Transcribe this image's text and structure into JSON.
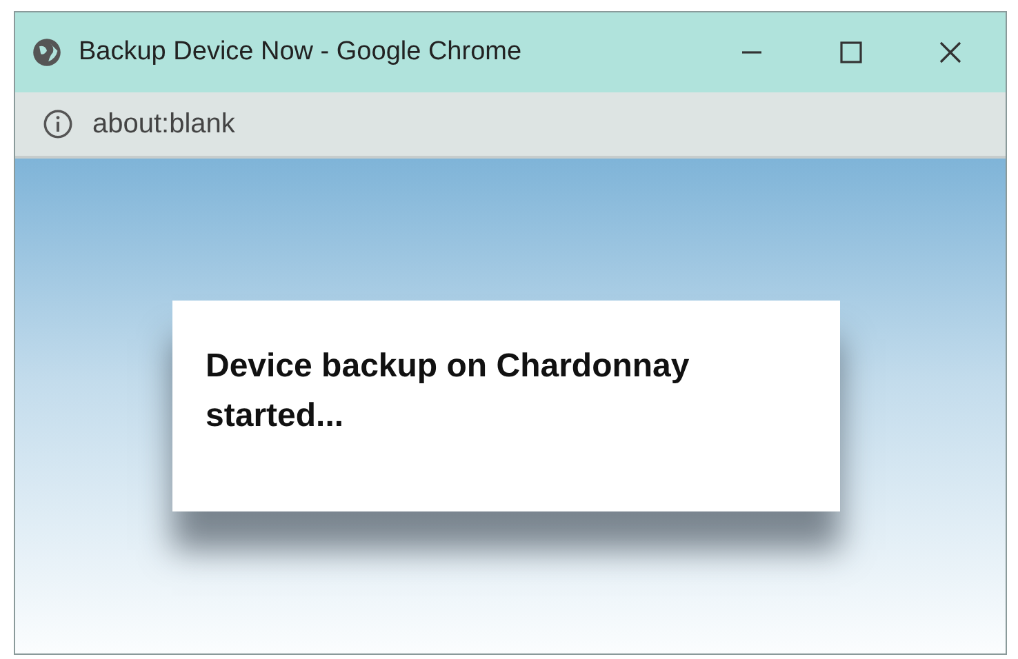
{
  "window": {
    "title": "Backup Device Now - Google Chrome"
  },
  "address_bar": {
    "url": "about:blank"
  },
  "dialog": {
    "message": "Device backup on Chardonnay started..."
  }
}
